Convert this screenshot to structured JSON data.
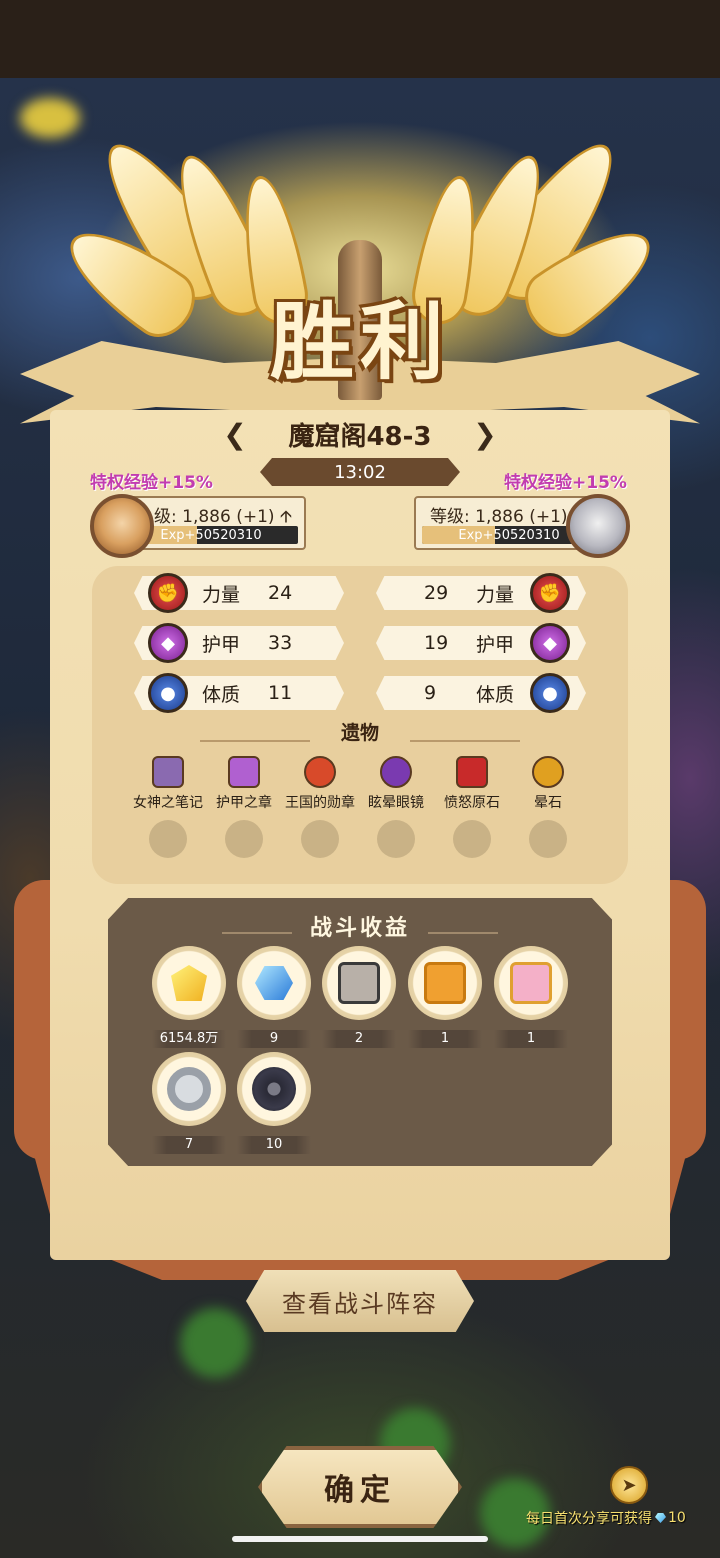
{
  "banner": {
    "title": "胜利"
  },
  "stage": {
    "name": "魔窟阁48-3",
    "prev_arrow": "❮",
    "next_arrow": "❯",
    "timer": "13:02"
  },
  "left_player": {
    "bonus": "特权经验+15%",
    "level_text": "级: 1,886 (+1) 🡩",
    "exp_text": "Exp+50520310",
    "exp_fill": 0.42
  },
  "right_player": {
    "bonus": "特权经验+15%",
    "level_text": "等级: 1,886 (+1)",
    "exp_text": "Exp+50520310",
    "exp_fill": 0.42
  },
  "stats": {
    "left": [
      {
        "label": "力量",
        "value": "24",
        "icon": "fist-icon"
      },
      {
        "label": "护甲",
        "value": "33",
        "icon": "armor-icon"
      },
      {
        "label": "体质",
        "value": "11",
        "icon": "constitution-icon"
      }
    ],
    "right": [
      {
        "label": "力量",
        "value": "29",
        "icon": "fist-icon"
      },
      {
        "label": "护甲",
        "value": "19",
        "icon": "armor-icon"
      },
      {
        "label": "体质",
        "value": "9",
        "icon": "constitution-icon"
      }
    ]
  },
  "relics": {
    "title": "遗物",
    "items": [
      {
        "name": "女神之笔记",
        "icon": "book-icon",
        "color": "#8a6ab0"
      },
      {
        "name": "护甲之章",
        "icon": "scroll-icon",
        "color": "#b060d0"
      },
      {
        "name": "王国的勋章",
        "icon": "medal-icon",
        "color": "#d84a2a"
      },
      {
        "name": "眩晕眼镜",
        "icon": "goggles-icon",
        "color": "#7a3ab0"
      },
      {
        "name": "愤怒原石",
        "icon": "red-stone-icon",
        "color": "#c82a2a"
      },
      {
        "name": "晕石",
        "icon": "gold-stone-icon",
        "color": "#e0a020"
      }
    ]
  },
  "rewards": {
    "title": "战斗收益",
    "items": [
      {
        "count": "6154.8万",
        "icon": "gold-gem-icon"
      },
      {
        "count": "9",
        "icon": "blue-diamond-icon"
      },
      {
        "count": "2",
        "icon": "dog-card-icon"
      },
      {
        "count": "1",
        "icon": "bird-card-icon"
      },
      {
        "count": "1",
        "icon": "pig-card-icon"
      },
      {
        "count": "7",
        "icon": "ring-icon"
      },
      {
        "count": "10",
        "icon": "gear-icon"
      }
    ]
  },
  "buttons": {
    "lineup": "查看战斗阵容",
    "confirm": "确定"
  },
  "share": {
    "text": "每日首次分享可获得",
    "amount": "10",
    "icon": "share-icon"
  },
  "colors": {
    "bonus": "#c23cb0",
    "panel": "#f0dcae",
    "rewards_bg": "#6b5a48",
    "accent": "#b5643a"
  }
}
